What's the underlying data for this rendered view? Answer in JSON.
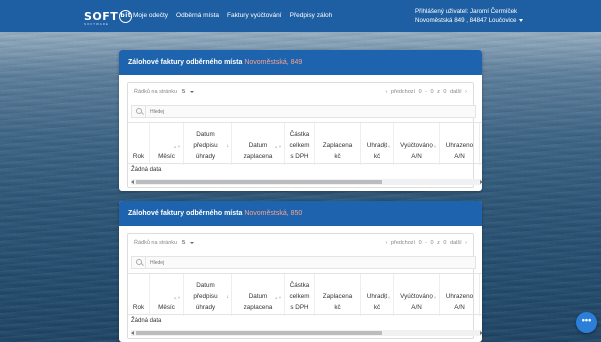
{
  "nav": {
    "logo_main": "SOFT",
    "logo_badge": "bit",
    "logo_sub": "SOFTWARE",
    "links": [
      "Moje odečty",
      "Odběrná místa",
      "Faktury vyúčtování",
      "Předpisy záloh"
    ],
    "user_line1": "Přihlášený uživatel: Jaromí Čermíček",
    "user_line2": "Novoměstská 849 , 84847 Loučovice"
  },
  "panels": [
    {
      "title": "Zálohové faktury odběrného místa",
      "address": "Novoměstská, 849",
      "rows_label": "Řádků na stránku",
      "rows_value": "5",
      "pager_prev": "‹ předchozí",
      "pager_range": "0 - 0 z 0",
      "pager_next": "další ›",
      "search_placeholder": "Hledej",
      "columns": [
        "Rok",
        "Měsíc",
        "Datum předpisu úhrady",
        "Datum zaplacena",
        "Částka celkem s DPH",
        "Zaplacena kč",
        "Uhradit kč",
        "Vyúčtováno A/N",
        "Uhrazeno A/N"
      ],
      "empty_text": "Žádná data"
    },
    {
      "title": "Zálohové faktury odběrného místa",
      "address": "Novoměstská, 850",
      "rows_label": "Řádků na stránku",
      "rows_value": "5",
      "pager_prev": "‹ předchozí",
      "pager_range": "0 - 0 z 0",
      "pager_next": "další ›",
      "search_placeholder": "Hledej",
      "columns": [
        "Rok",
        "Měsíc",
        "Datum předpisu úhrady",
        "Datum zaplacena",
        "Částka celkem s DPH",
        "Zaplacena kč",
        "Uhradit kč",
        "Vyúčtováno A/N",
        "Uhrazeno A/N"
      ],
      "empty_text": "Žádná data"
    }
  ],
  "chat_button_label": "•••"
}
